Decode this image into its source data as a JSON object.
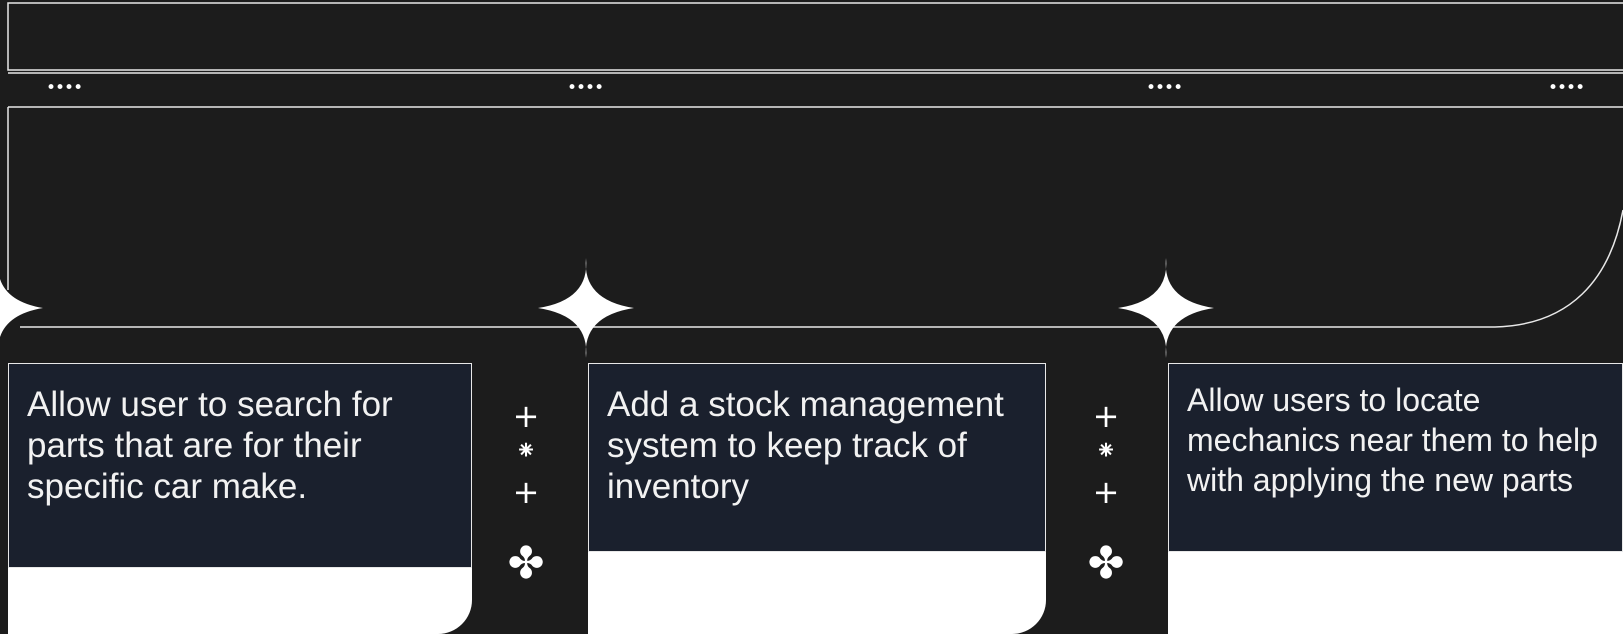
{
  "menu_icon": "ellipsis-dots-icon",
  "dot_groups": [
    "••••",
    "••••",
    "••••",
    "••••"
  ],
  "cards": [
    {
      "text": "Allow user to search for parts that are for their specific car make."
    },
    {
      "text": "Add a stock management system to keep track of inventory"
    },
    {
      "text": "Allow users to locate mechanics near them to help with applying the new parts"
    }
  ],
  "ornaments": {
    "plus": "+",
    "asterisk": "⁕",
    "flower": "✤"
  },
  "colors": {
    "background": "#1c1c1c",
    "card_panel": "#1a202d",
    "card_body": "#ffffff",
    "lines": "#ffffff"
  }
}
